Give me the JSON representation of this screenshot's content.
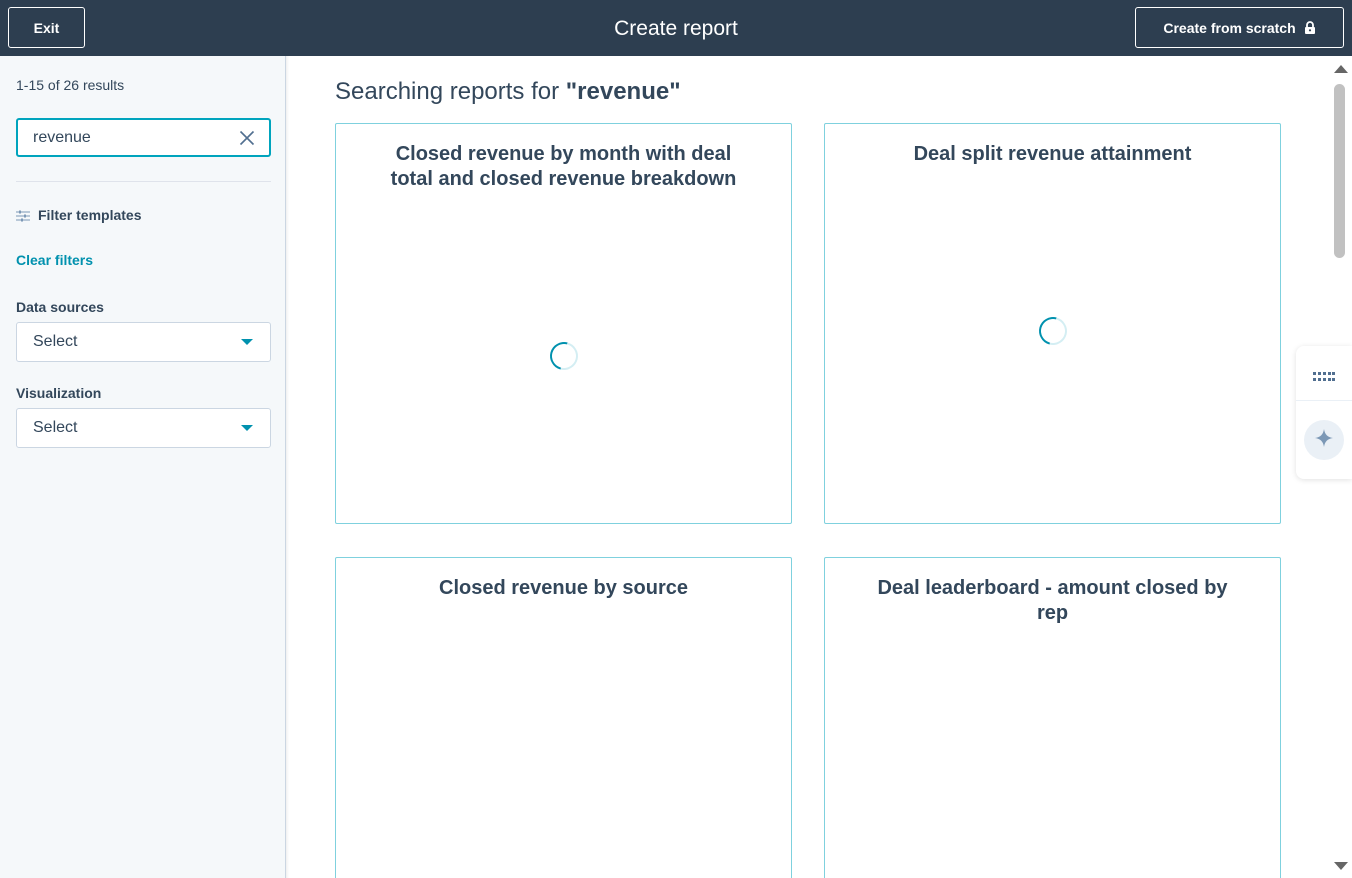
{
  "topbar": {
    "exit_label": "Exit",
    "title": "Create report",
    "create_scratch_label": "Create from scratch"
  },
  "sidebar": {
    "results_count": "1-15 of 26 results",
    "search": {
      "value": "revenue"
    },
    "filter_label": "Filter templates",
    "clear_filters_label": "Clear filters",
    "data_sources": {
      "label": "Data sources",
      "value": "Select"
    },
    "visualization": {
      "label": "Visualization",
      "value": "Select"
    }
  },
  "main": {
    "heading_prefix": "Searching reports for",
    "heading_query": "\"revenue\"",
    "cards": [
      {
        "title": "Closed revenue by month with deal total and closed revenue breakdown",
        "loading": true
      },
      {
        "title": "Deal split revenue attainment",
        "loading": true
      },
      {
        "title": "Closed revenue by source",
        "loading": false
      },
      {
        "title": "Deal leaderboard - amount closed by rep",
        "loading": false
      }
    ]
  },
  "colors": {
    "topbar": "#2d3e50",
    "accent": "#00a4bd",
    "link": "#0091ae",
    "text": "#33475b"
  }
}
